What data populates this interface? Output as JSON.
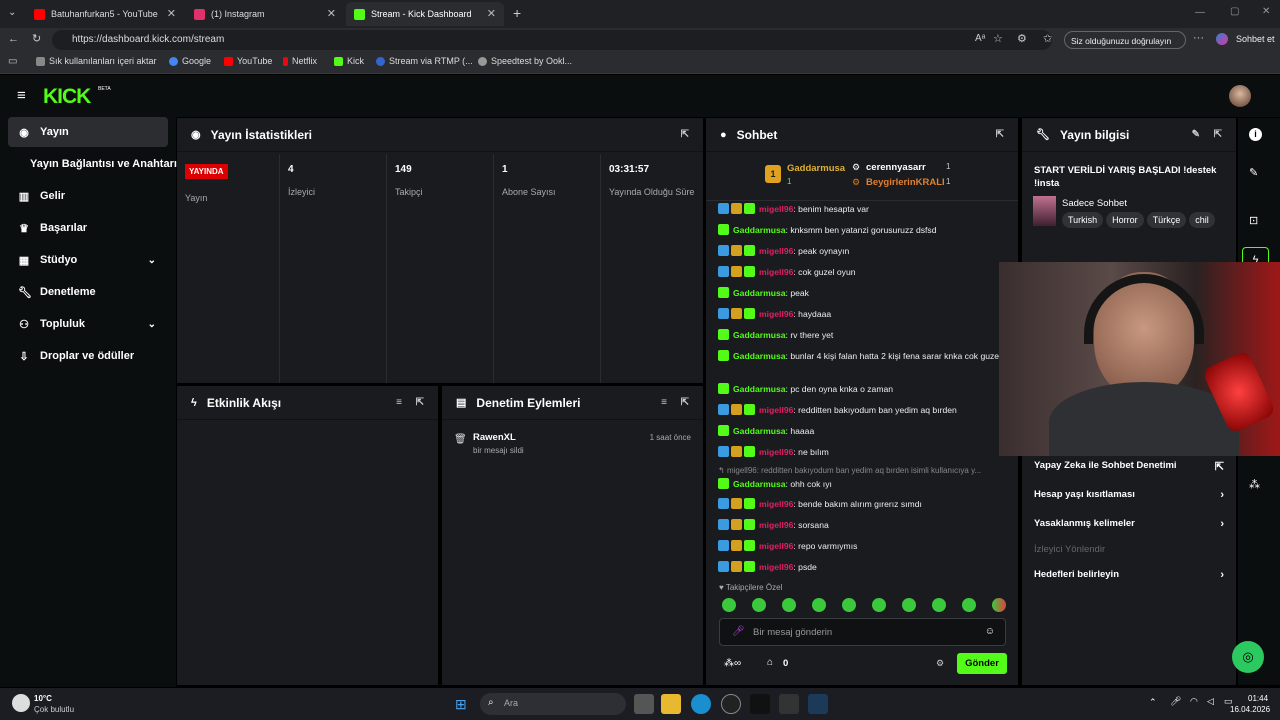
{
  "browser": {
    "tabs": [
      {
        "title": "Batuhanfurkan5 - YouTube",
        "color": "#ff0000"
      },
      {
        "title": "(1) Instagram",
        "color": "#e1306c"
      },
      {
        "title": "Stream - Kick Dashboard",
        "color": "#53fc18"
      }
    ],
    "url": "https://dashboard.kick.com/stream",
    "verify_label": "Siz olduğunuzu doğrulayın",
    "chat_label": "Sohbet et",
    "bookmarks": [
      {
        "label": "Sık kullanılanları içeri aktar",
        "color": "#888888"
      },
      {
        "label": "Google",
        "color": "#4285f4"
      },
      {
        "label": "YouTube",
        "color": "#ff0000"
      },
      {
        "label": "Netflix",
        "color": "#e50914"
      },
      {
        "label": "Kick",
        "color": "#53fc18"
      },
      {
        "label": "Stream via RTMP (...",
        "color": "#3366cc"
      },
      {
        "label": "Speedtest by Ookl...",
        "color": "#999999"
      }
    ]
  },
  "app": {
    "logo": "KICK",
    "beta": "BETA"
  },
  "sidebar": {
    "items": [
      {
        "label": "Yayın",
        "icon": "broadcast-icon"
      },
      {
        "label": "Yayın Bağlantısı ve Anahtarı",
        "icon": ""
      },
      {
        "label": "Gelir",
        "icon": "chart-icon"
      },
      {
        "label": "Başarılar",
        "icon": "trophy-icon"
      },
      {
        "label": "Stüdyo",
        "icon": "studio-icon"
      },
      {
        "label": "Denetleme",
        "icon": "wrench-icon"
      },
      {
        "label": "Topluluk",
        "icon": "community-icon"
      },
      {
        "label": "Droplar ve ödüller",
        "icon": "drops-icon"
      }
    ]
  },
  "stats": {
    "title": "Yayın İstatistikleri",
    "live_badge": "YAYINDA",
    "stream_label": "Yayın",
    "items": [
      {
        "value": "4",
        "label": "İzleyici"
      },
      {
        "value": "149",
        "label": "Takipçi"
      },
      {
        "value": "1",
        "label": "Abone Sayısı"
      },
      {
        "value": "03:31:57",
        "label": "Yayında Olduğu Süre"
      }
    ]
  },
  "activity": {
    "title": "Etkinlik Akışı"
  },
  "moderation": {
    "title": "Denetim Eylemleri",
    "entry_user": "RawenXL",
    "entry_action": "bir mesajı sildi",
    "entry_time": "1 saat önce"
  },
  "chat": {
    "title": "Sohbet",
    "leaderboard": {
      "first_rank": "1",
      "first_name": "Gaddarmusa",
      "first_count": "1",
      "second_name": "cerennyasarr",
      "second_count": "1",
      "third_name": "BeygirlerinKRALI",
      "third_count": "1"
    },
    "messages": [
      {
        "user": "migell96",
        "text": ": benim hesapta var",
        "style": "r"
      },
      {
        "user": "Gaddarmusa",
        "text": ": knksmm ben yatanzi gorusuruzz dsfsd",
        "style": "g"
      },
      {
        "user": "migell96",
        "text": ": peak oynayın",
        "style": "r"
      },
      {
        "user": "migell96",
        "text": ": cok guzel oyun",
        "style": "r"
      },
      {
        "user": "Gaddarmusa",
        "text": ": peak",
        "style": "g"
      },
      {
        "user": "migell96",
        "text": ": haydaaa",
        "style": "r"
      },
      {
        "user": "Gaddarmusa",
        "text": ": rv there yet",
        "style": "g"
      },
      {
        "user": "Gaddarmusa",
        "text": ": bunlar 4 kişi falan hatta 2 kişi fena sarar knka cok guzel",
        "style": "g"
      },
      {
        "user": "Gaddarmusa",
        "text": ": pc den oyna knka o zaman",
        "style": "g"
      },
      {
        "user": "migell96",
        "text": ": redditten bakıyodum ban yedim aq bırden",
        "style": "r"
      },
      {
        "user": "Gaddarmusa",
        "text": ": haaaa",
        "style": "g"
      },
      {
        "user": "migell96",
        "text": ": ne bılım",
        "style": "r"
      },
      {
        "user": "",
        "text": "migell96: redditten bakıyodum ban yedim aq bırden isimli kullanıcıya y...",
        "style": "reply"
      },
      {
        "user": "Gaddarmusa",
        "text": ": ohh cok ıyı",
        "style": "g"
      },
      {
        "user": "migell96",
        "text": ": bende bakım alırım gırerız sımdı",
        "style": "r"
      },
      {
        "user": "migell96",
        "text": ": sorsana",
        "style": "r"
      },
      {
        "user": "migell96",
        "text": ": repo varmıymıs",
        "style": "r"
      },
      {
        "user": "migell96",
        "text": ": psde",
        "style": "r"
      }
    ],
    "followers_only": "Takipçilere Özel",
    "input_placeholder": "Bir mesaj gönderin",
    "points_value": "0",
    "send_label": "Gönder"
  },
  "stream_info": {
    "title": "Yayın bilgisi",
    "stream_title": "START VERİLDİ YARIŞ BAŞLADI !destek !insta",
    "category": "Sadece Sohbet",
    "tags": [
      "Turkish",
      "Horror",
      "Türkçe",
      "chil"
    ],
    "settings": [
      "Yapay Zeka ile Sohbet Denetimi",
      "Hesap yaşı kısıtlaması",
      "Yasaklanmış kelimeler",
      "İzleyici Yönlendir",
      "Hedefleri belirleyin"
    ]
  },
  "taskbar": {
    "temp": "10°C",
    "weather": "Çok bulutlu",
    "search_placeholder": "Ara",
    "time": "01:44",
    "date": "16.04.2026"
  }
}
